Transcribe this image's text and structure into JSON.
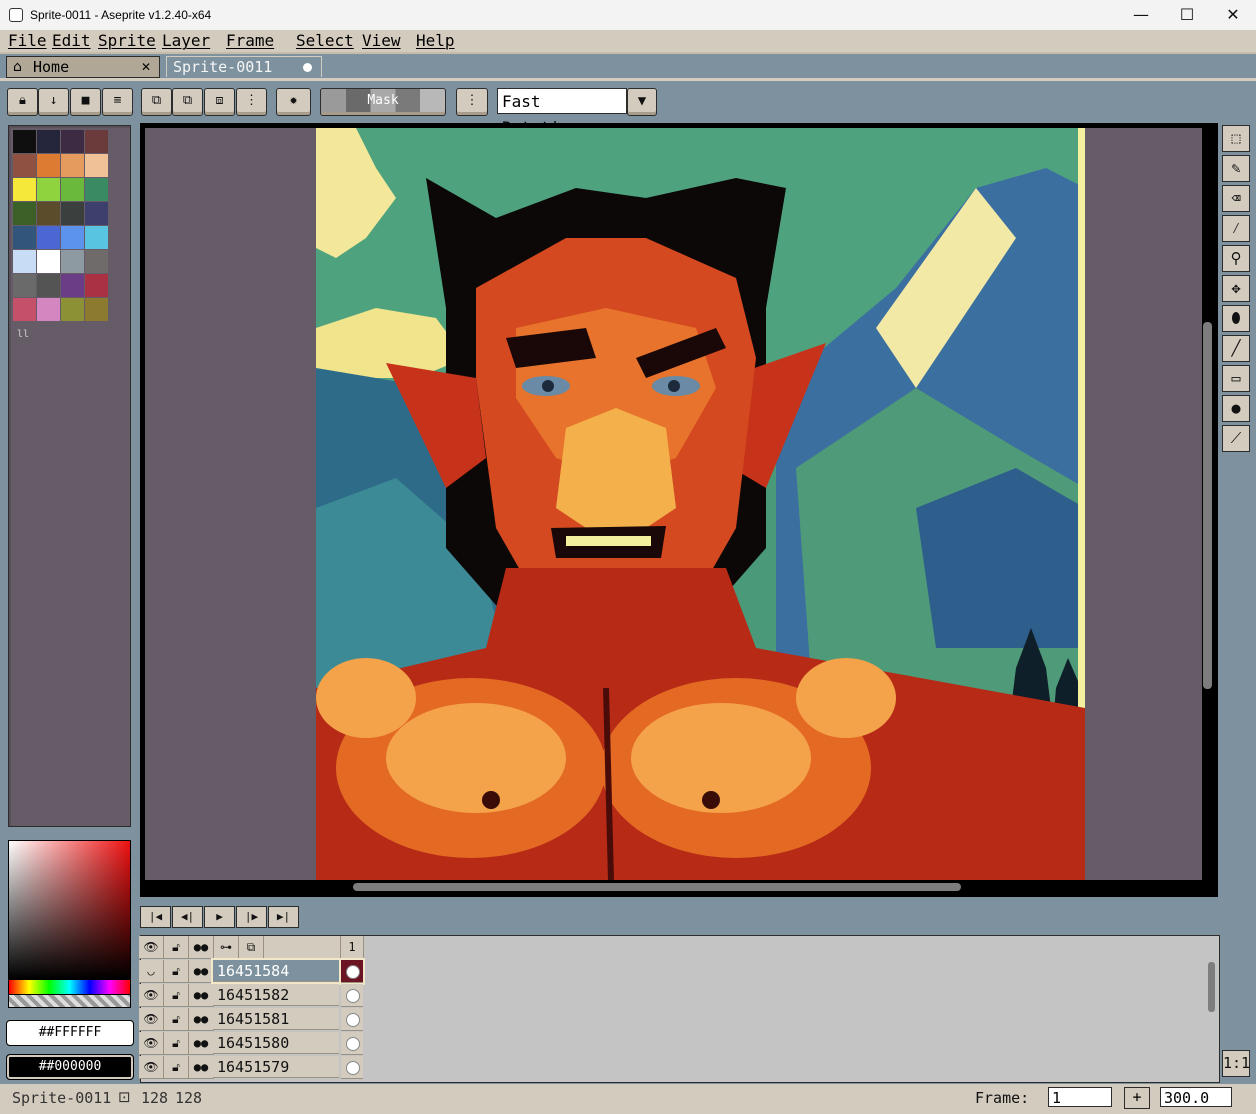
{
  "window": {
    "title": "Sprite-0011 - Aseprite v1.2.40-x64",
    "minimize": "—",
    "maximize": "☐",
    "close": "✕"
  },
  "menu": [
    "File",
    "Edit",
    "Sprite",
    "Layer",
    "Frame",
    "Select",
    "View",
    "Help"
  ],
  "tabs": [
    {
      "label": "Home",
      "close": "✕",
      "icon": "home-icon"
    },
    {
      "label": "Sprite-0011",
      "icon": "modified-dot-icon"
    }
  ],
  "toolbar": {
    "mask_label": "Mask",
    "rotation_value": "Fast Rotation",
    "dropdown_arrow": "▼"
  },
  "palette": {
    "colors": [
      "#0f0f10",
      "#25253c",
      "#3c2b43",
      "#6a3b3a",
      "#8f5141",
      "#dc7b31",
      "#e59a5e",
      "#f0c096",
      "#f5e83a",
      "#8fd33f",
      "#6ab93d",
      "#3a8a63",
      "#3c6128",
      "#5b4c2b",
      "#3b3f3e",
      "#3d406c",
      "#31557b",
      "#4b68d2",
      "#5c93ec",
      "#59c4e2",
      "#c9dcf5",
      "#ffffff",
      "#8d9aa2",
      "#6e6b6a",
      "#6a6a6a",
      "#545454",
      "#6c3d87",
      "#aa3043",
      "#c4506a",
      "#d486c0",
      "#8d9136",
      "#8c7a2f"
    ]
  },
  "colors": {
    "foreground": "#FFFFFF",
    "background": "#000000"
  },
  "layers": [
    {
      "name": "16451584",
      "selected": true
    },
    {
      "name": "16451582",
      "selected": false
    },
    {
      "name": "16451581",
      "selected": false
    },
    {
      "name": "16451580",
      "selected": false
    },
    {
      "name": "16451579",
      "selected": false
    }
  ],
  "timeline": {
    "frame_header": "1"
  },
  "status": {
    "sprite_name": "Sprite-0011",
    "width": "128",
    "height": "128",
    "frame_label": "Frame:",
    "frame_value": "1",
    "plus": "+",
    "zoom_value": "300.0"
  },
  "zoom_one_to_one": "1:1"
}
